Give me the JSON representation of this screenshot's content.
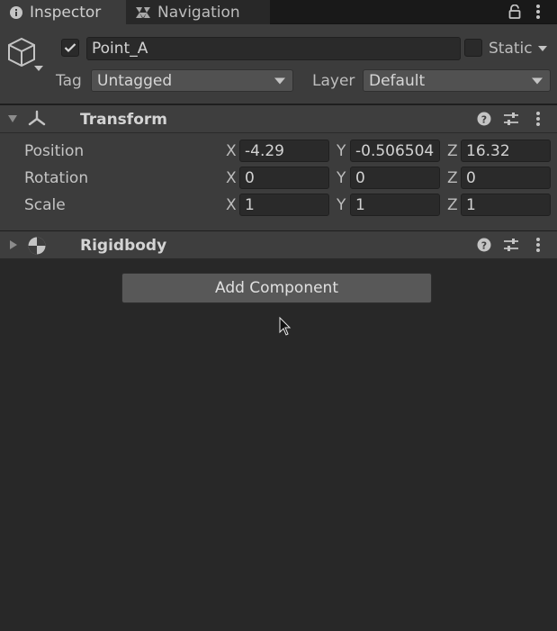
{
  "tabs": [
    {
      "label": "Inspector",
      "icon": "info-icon",
      "active": true
    },
    {
      "label": "Navigation",
      "icon": "navmesh-icon",
      "active": false
    }
  ],
  "object": {
    "enabled": true,
    "name": "Point_A",
    "static_label": "Static",
    "static_checked": false,
    "tag_label": "Tag",
    "tag_value": "Untagged",
    "layer_label": "Layer",
    "layer_value": "Default"
  },
  "transform": {
    "title": "Transform",
    "rows": [
      {
        "label": "Position",
        "x": "-4.29",
        "y": "-0.506504",
        "z": "16.32"
      },
      {
        "label": "Rotation",
        "x": "0",
        "y": "0",
        "z": "0"
      },
      {
        "label": "Scale",
        "x": "1",
        "y": "1",
        "z": "1"
      }
    ],
    "axes": {
      "x": "X",
      "y": "Y",
      "z": "Z"
    }
  },
  "rigidbody": {
    "title": "Rigidbody"
  },
  "add_component_label": "Add Component"
}
